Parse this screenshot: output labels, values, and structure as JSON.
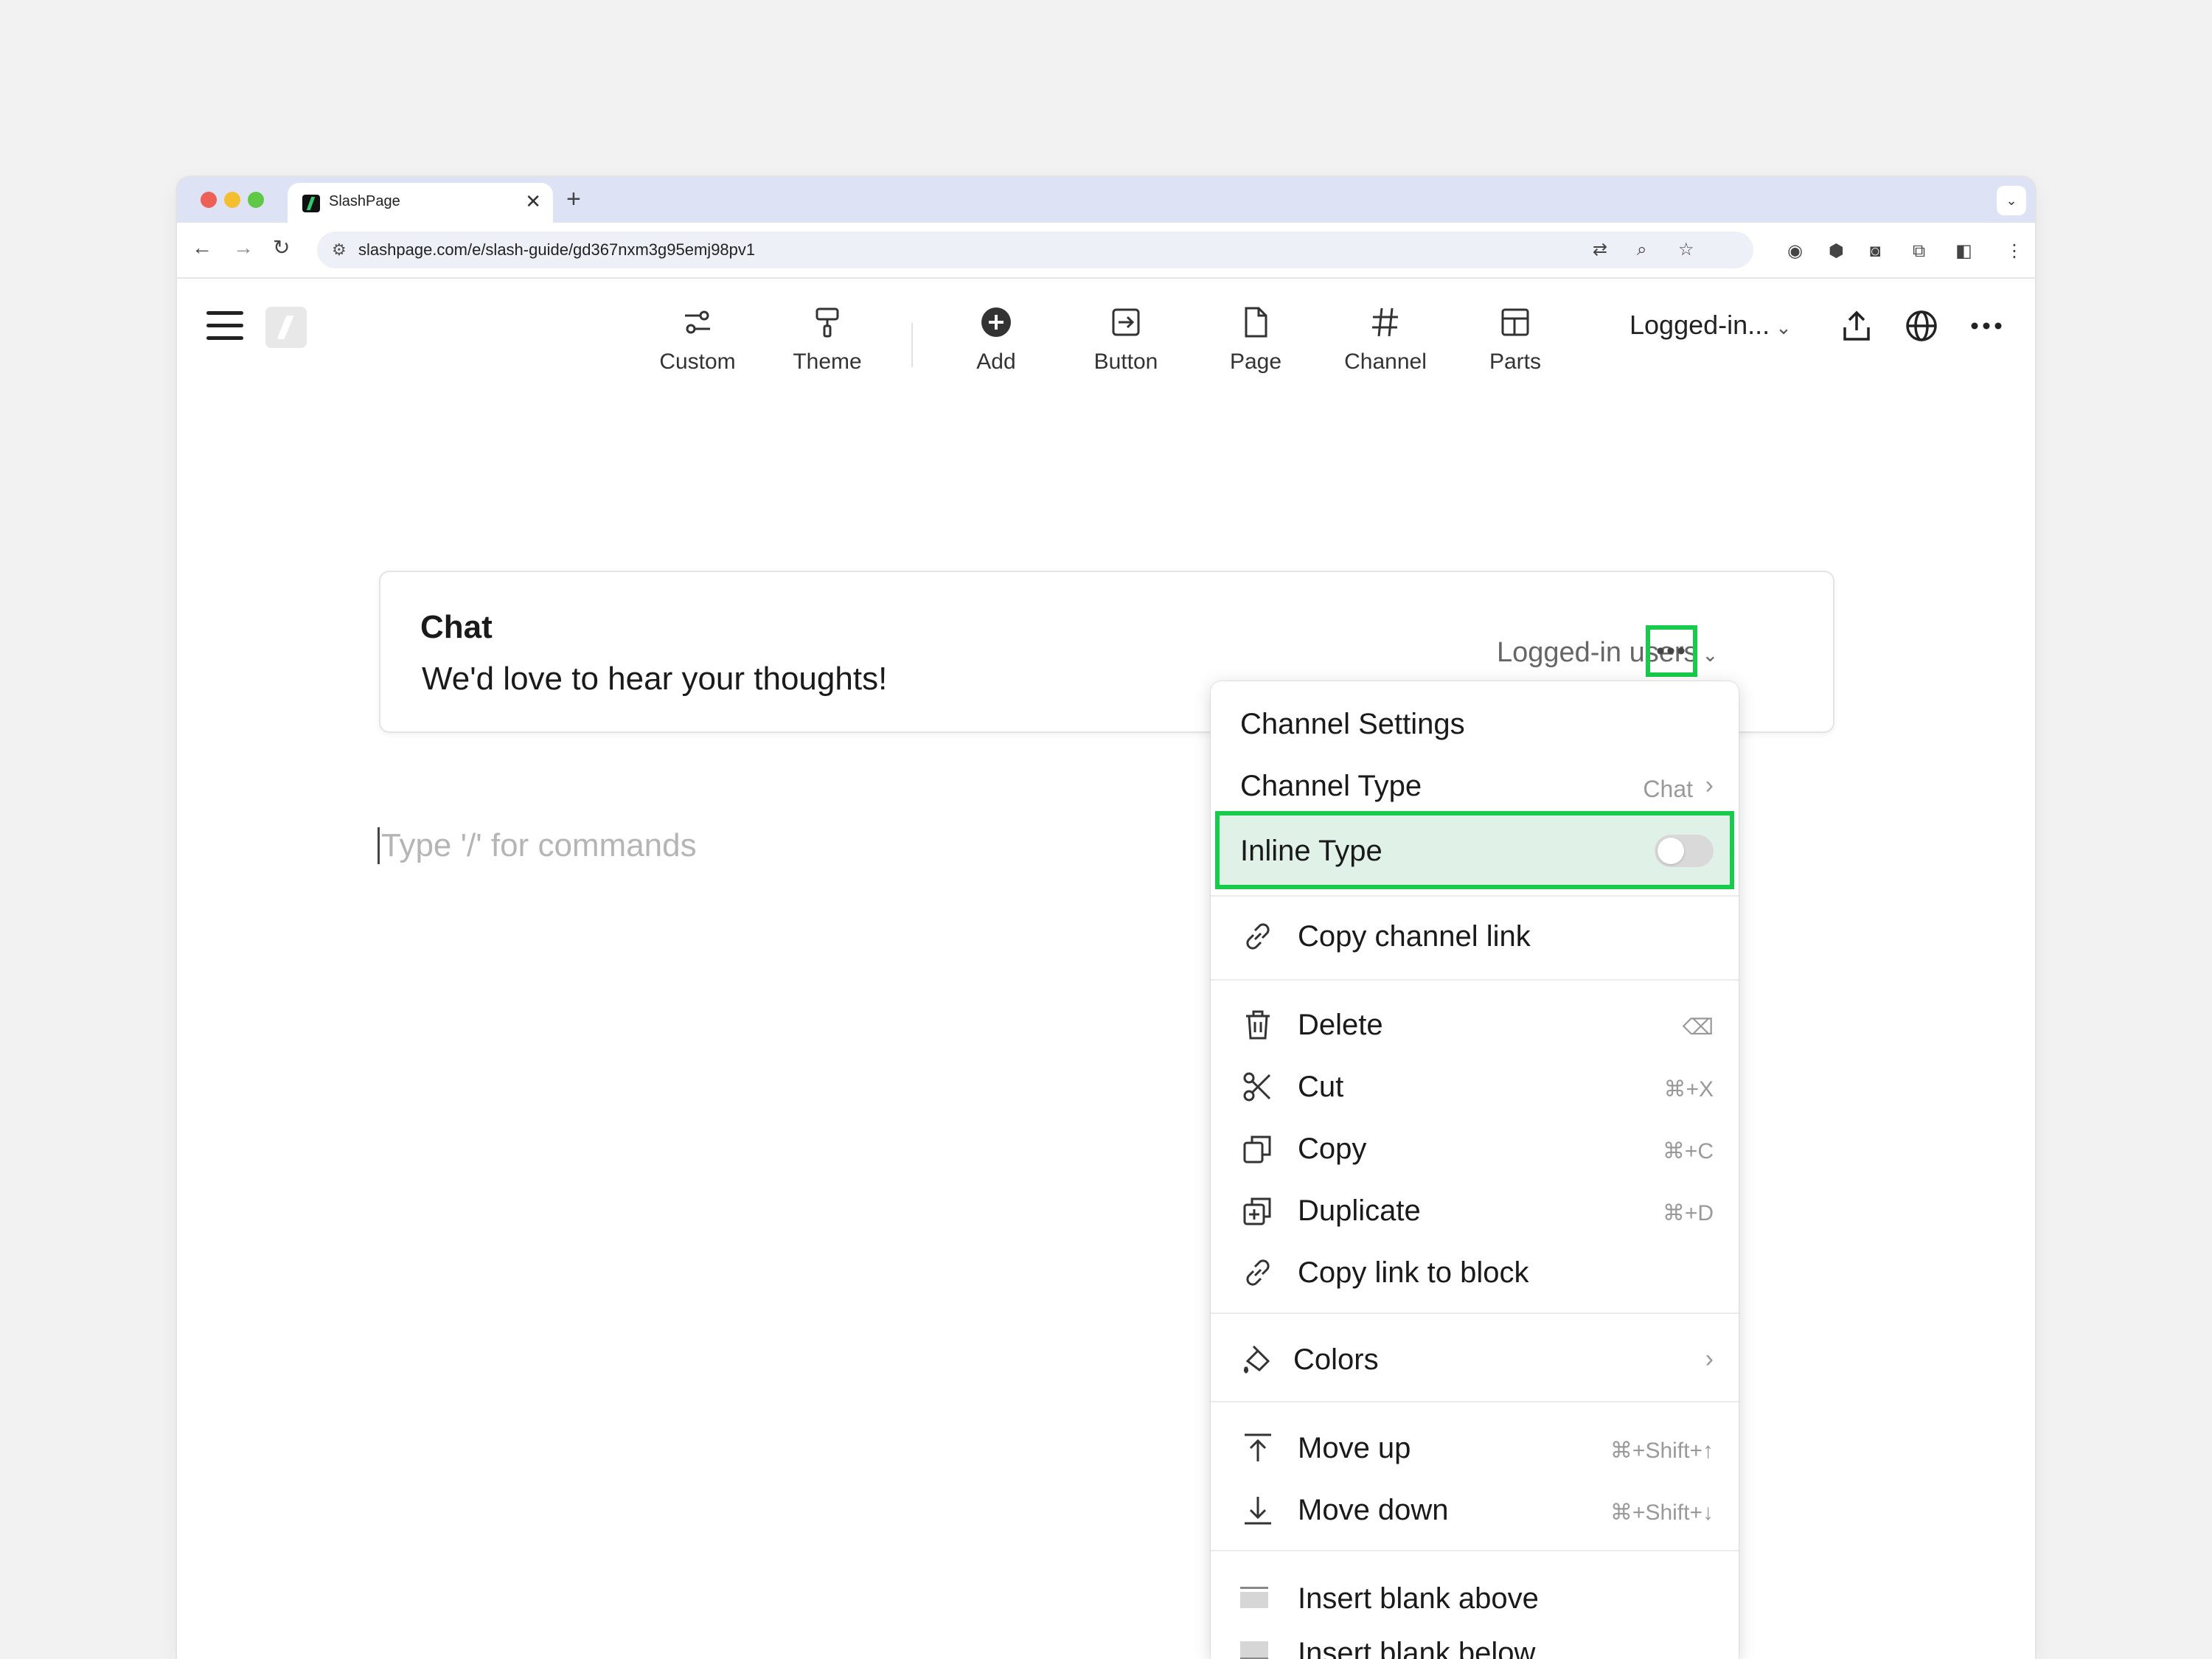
{
  "browser": {
    "tab_title": "SlashPage",
    "tab_close": "✕",
    "new_tab": "+",
    "url": "slashpage.com/e/slash-guide/gd367nxm3g95emj98pv1"
  },
  "header": {
    "tools": [
      {
        "label": "Custom",
        "icon": "sliders-icon"
      },
      {
        "label": "Theme",
        "icon": "paint-roller-icon"
      },
      {
        "label": "Add",
        "icon": "plus-circle-icon"
      },
      {
        "label": "Button",
        "icon": "button-arrow-icon"
      },
      {
        "label": "Page",
        "icon": "page-icon"
      },
      {
        "label": "Channel",
        "icon": "hash-icon"
      },
      {
        "label": "Parts",
        "icon": "layout-icon"
      }
    ],
    "visibility_select": "Logged-in..."
  },
  "chat_block": {
    "title": "Chat",
    "subtitle": "We'd love to hear your thoughts!",
    "access": "Logged-in users"
  },
  "editor": {
    "placeholder": "Type '/' for commands"
  },
  "context_menu": {
    "channel_settings": "Channel Settings",
    "channel_type": "Channel Type",
    "channel_type_value": "Chat",
    "inline_type": "Inline Type",
    "inline_type_on": false,
    "copy_channel_link": "Copy channel link",
    "delete": "Delete",
    "cut": "Cut",
    "cut_shortcut": "⌘+X",
    "copy": "Copy",
    "copy_shortcut": "⌘+C",
    "duplicate": "Duplicate",
    "duplicate_shortcut": "⌘+D",
    "copy_link_to_block": "Copy link to block",
    "colors": "Colors",
    "move_up": "Move up",
    "move_up_shortcut": "⌘+Shift+↑",
    "move_down": "Move down",
    "move_down_shortcut": "⌘+Shift+↓",
    "insert_blank_above": "Insert blank above",
    "insert_blank_below": "Insert blank below"
  },
  "colors": {
    "highlight": "#16cc4a",
    "highlight_fill": "#e0f2e8"
  }
}
